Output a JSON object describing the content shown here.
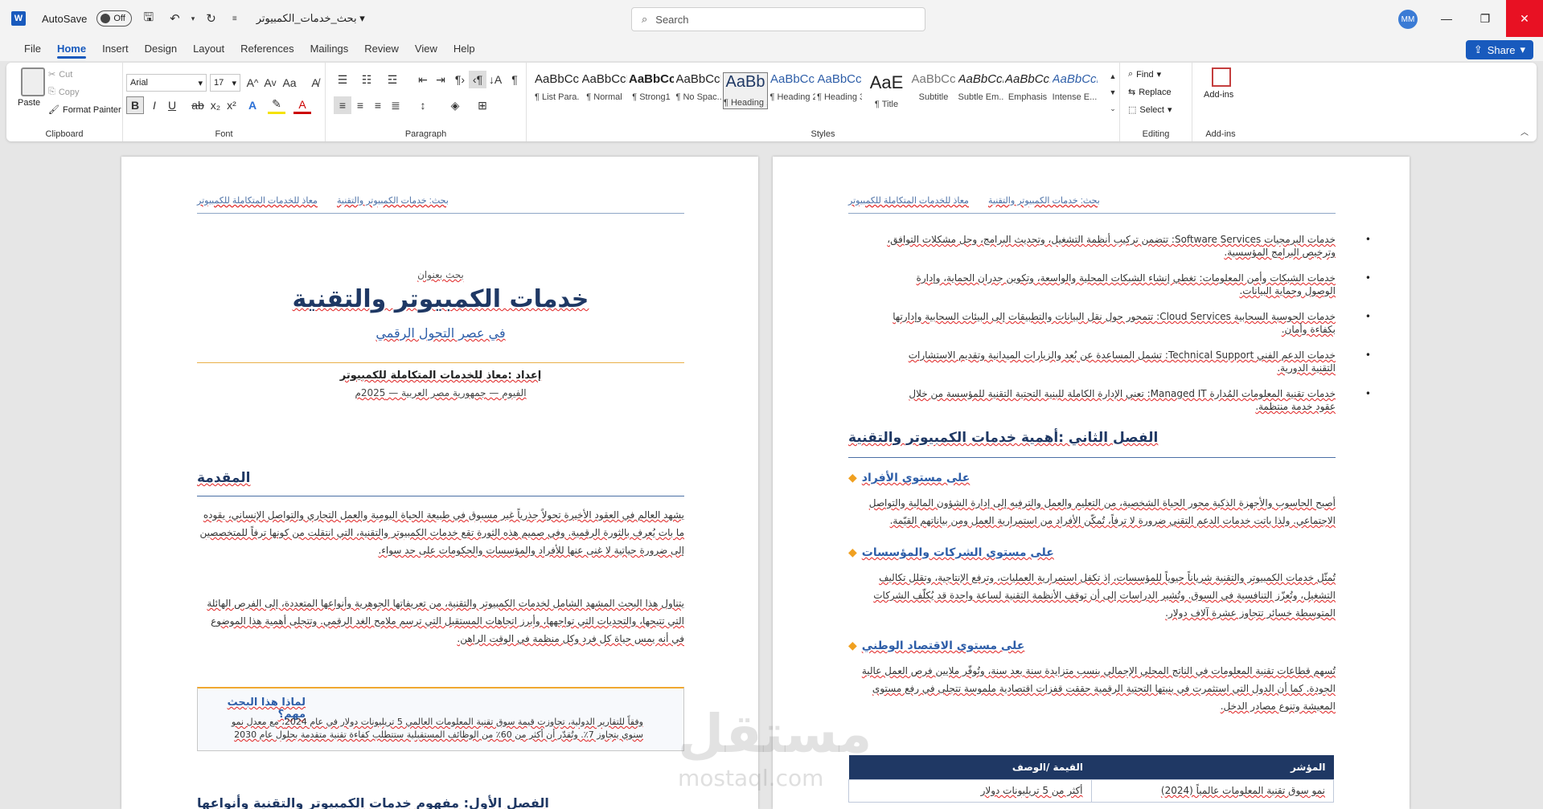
{
  "titlebar": {
    "app_logo": "W",
    "autosave_label": "AutoSave",
    "autosave_state": "Off",
    "doc_title": "بحث_خدمات_الكمبيوتر",
    "search_placeholder": "Search",
    "user_initials": "MM"
  },
  "menu": {
    "tabs": [
      "File",
      "Home",
      "Insert",
      "Design",
      "Layout",
      "References",
      "Mailings",
      "Review",
      "View",
      "Help"
    ],
    "active": "Home",
    "share_label": "Share"
  },
  "ribbon": {
    "clipboard": {
      "paste": "Paste",
      "cut": "Cut",
      "copy": "Copy",
      "format_painter": "Format Painter",
      "label": "Clipboard"
    },
    "font": {
      "name": "Arial",
      "size": "17",
      "label": "Font"
    },
    "paragraph": {
      "label": "Paragraph"
    },
    "styles": {
      "label": "Styles",
      "items": [
        {
          "sample": "AaBbCcI",
          "name": "¶ List Para..."
        },
        {
          "sample": "AaBbCcI",
          "name": "¶ Normal"
        },
        {
          "sample": "AaBbCcI",
          "name": "¶ Strong1"
        },
        {
          "sample": "AaBbCcI",
          "name": "¶ No Spac..."
        },
        {
          "sample": "AaBb",
          "name": "¶ Heading 1"
        },
        {
          "sample": "AaBbCc",
          "name": "¶ Heading 2"
        },
        {
          "sample": "AaBbCc",
          "name": "¶ Heading 3"
        },
        {
          "sample": "AaE",
          "name": "¶ Title"
        },
        {
          "sample": "AaBbCc",
          "name": "Subtitle"
        },
        {
          "sample": "AaBbCcI",
          "name": "Subtle Em..."
        },
        {
          "sample": "AaBbCcI",
          "name": "Emphasis"
        },
        {
          "sample": "AaBbCcI",
          "name": "Intense E..."
        }
      ]
    },
    "editing": {
      "find": "Find",
      "replace": "Replace",
      "select": "Select",
      "label": "Editing"
    },
    "addins": {
      "button": "Add-ins",
      "label": "Add-ins"
    }
  },
  "page1": {
    "header_left": "معاذ للخدمات المتكاملة للكمبيوتر",
    "header_right": "بحث: خدمات الكمبيوتر والتقنية",
    "kicker": "بحث بعنوان",
    "title": "خدمات الكمبيوتر والتقنية",
    "subtitle": "في عصر التحول الرقمي",
    "prepared_by": "إعداد :معاذ للخدمات المتكاملة للكمبيوتر",
    "place_date": "الفيوم — جمهورية مصر العربية — 2025م",
    "intro_heading": "المقدمة",
    "intro_p1": "يشهد العالم في العقود الأخيرة تحولاً جذرياً غير مسبوق في طبيعة الحياة اليومية والعمل التجاري والتواصل الإنساني، يقوده ما بات يُعرف بالثورة الرقمية. وفي صميم هذه الثورة تقع خدمات الكمبيوتر والتقنية، التي انتقلت من كونها ترفاً للمتخصصين إلى ضرورة حياتية لا غنى عنها للأفراد والمؤسسات والحكومات على حد سواء.",
    "intro_p2": "يتناول هذا البحث المشهد الشامل لخدمات الكمبيوتر والتقنية، من تعريفاتها الجوهرية وأنواعها المتعددة، إلى الفرص الهائلة التي تتيحها، والتحديات التي تواجهها، وأبرز اتجاهات المستقبل التي ترسم ملامح الغد الرقمي. وتتجلى أهمية هذا الموضوع في أنه يمس حياة كل فرد وكل منظمة في الوقت الراهن.",
    "callout_title": "لماذا هذا البحث مهم؟",
    "callout_text": "وفقاً للتقارير الدولية، تجاوزت قيمة سوق تقنية المعلومات العالمي 5 تريليونات دولار في عام 2024، مع معدل نمو سنوي يتجاوز 7٪. وتُقدّر أن أكثر من 60٪ من الوظائف المستقبلية ستتطلب كفاءة تقنية متقدمة بحلول عام 2030",
    "chapter1_heading": "الفصل الأول: مفهوم خدمات الكمبيوتر والتقنية وأنواعها"
  },
  "page2": {
    "header_left": "معاذ للخدمات المتكاملة للكمبيوتر",
    "header_right": "بحث: خدمات الكمبيوتر والتقنية",
    "bullets": [
      "خدمات البرمجيات Software Services: تتضمن تركيب أنظمة التشغيل، وتحديث البرامج، وحل مشكلات التوافق، وترخيص البرامج المؤسسية.",
      "خدمات الشبكات وأمن المعلومات: تغطي إنشاء الشبكات المحلية والواسعة، وتكوين جدران الحماية، وإدارة الوصول وحماية البيانات.",
      "خدمات الحوسبة السحابية Cloud Services: تتمحور حول نقل البيانات والتطبيقات إلى البيئات السحابية وإدارتها بكفاءة وأمان.",
      "خدمات الدعم الفني Technical Support: تشمل المساعدة عن بُعد والزيارات الميدانية وتقديم الاستشارات التقنية الدورية.",
      "خدمات تقنية المعلومات المُدارة Managed IT: تعني الإدارة الكاملة للبنية التحتية التقنية للمؤسسة من خلال عقود خدمة منتظمة."
    ],
    "chapter2_heading": "الفصل الثاني :أهمية خدمات الكمبيوتر والتقنية",
    "sec1_title": "على مستوى الأفراد",
    "sec1_text": "أصبح الحاسوب والأجهزة الذكية محور الحياة الشخصية، من التعليم والعمل والترفيه إلى إدارة الشؤون المالية والتواصل الاجتماعي. ولذا باتت خدمات الدعم التقني ضرورة لا ترفاً، تُمكّن الأفراد من استمرارية العمل ومن بياناتهم القيّمة.",
    "sec2_title": "على مستوى الشركات والمؤسسات",
    "sec2_text": "تُمثّل خدمات الكمبيوتر والتقنية شرياناً حيوياً للمؤسسات، إذ تكفل استمرارية العمليات، وترفع الإنتاجية، وتقلل تكاليف التشغيل، وتُعزّز التنافسية في السوق. وتُشير الدراسات إلى أن توقف الأنظمة التقنية لساعة واحدة قد يُكلّف الشركات المتوسطة خسائر تتجاوز عشرة آلاف دولار.",
    "sec3_title": "على مستوى الاقتصاد الوطني",
    "sec3_text": "تُسهم قطاعات تقنية المعلومات في الناتج المحلي الإجمالي بنسب متزايدة سنة بعد سنة، وتُوفّر ملايين فرص العمل عالية الجودة. كما أن الدول التي استثمرت في بنيتها التحتية الرقمية حققت قفزات اقتصادية ملموسة تتجلى في رفع مستوى المعيشة وتنوع مصادر الدخل.",
    "table": {
      "col_indicator": "المؤشر",
      "col_value": "القيمة /الوصف",
      "rows": [
        {
          "indicator": "نمو سوق تقنية المعلومات عالمياً (2024)",
          "value": "أكثر من 5 تريليونات دولار"
        }
      ]
    }
  },
  "watermark": {
    "ar": "مستقل",
    "en": "mostaql.com"
  },
  "colors": {
    "accent": "#185abd",
    "heading": "#1f3864",
    "close": "#e81123"
  }
}
